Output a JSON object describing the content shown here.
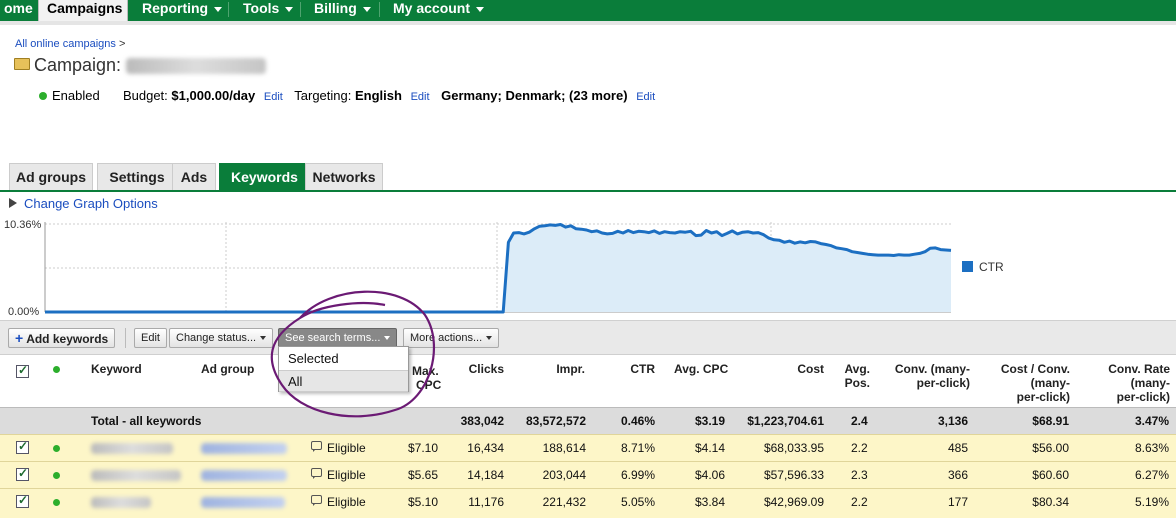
{
  "nav": {
    "items": [
      {
        "label": "ome"
      },
      {
        "label": "Campaigns"
      },
      {
        "label": "Reporting"
      },
      {
        "label": "Tools"
      },
      {
        "label": "Billing"
      },
      {
        "label": "My account"
      }
    ]
  },
  "breadcrumb": {
    "link": "All online campaigns",
    "sep": ">"
  },
  "campaign": {
    "title_prefix": "Campaign:",
    "status": "Enabled",
    "budget_label": "Budget:",
    "budget_value": "$1,000.00/day",
    "targeting_label": "Targeting:",
    "targeting_language": "English",
    "targeting_locations": "Germany; Denmark; (23 more)",
    "edit_label": "Edit"
  },
  "tabs": [
    "Ad groups",
    "Settings",
    "Ads",
    "Keywords",
    "Networks"
  ],
  "graph": {
    "options_link": "Change Graph Options"
  },
  "chart_data": {
    "type": "area",
    "series": [
      {
        "name": "CTR",
        "values": [
          0,
          0,
          0,
          0,
          0,
          0,
          0,
          0,
          0,
          0,
          0,
          0,
          0,
          0,
          0,
          0,
          0,
          0,
          0,
          0,
          0,
          0,
          0,
          0,
          0,
          0,
          0,
          0,
          0,
          0,
          0,
          0,
          0,
          0,
          0,
          0,
          0,
          0,
          0,
          0,
          0,
          0,
          0,
          0,
          0,
          0,
          0,
          0,
          0,
          0,
          0,
          0,
          0,
          0,
          0,
          0,
          0,
          0,
          0,
          0,
          0,
          0,
          0,
          0,
          0,
          0,
          0,
          0,
          0,
          0,
          0,
          0,
          0,
          0,
          0,
          0,
          0,
          0,
          0,
          0,
          0,
          0,
          0,
          0,
          0,
          0,
          0,
          0,
          0,
          8.2,
          9.3,
          9.35,
          9.2,
          9.4,
          9.8,
          10.1,
          10.15,
          10.25,
          10.2,
          10.3,
          10.0,
          10.15,
          9.8,
          9.75,
          9.65,
          9.45,
          9.55,
          9.3,
          9.2,
          9.25,
          9.5,
          9.3,
          9.6,
          9.35,
          9.5,
          9.45,
          9.35,
          9.55,
          9.25,
          9.45,
          9.35,
          9.3,
          9.45,
          9.4,
          9.5,
          9.0,
          9.05,
          9.6,
          9.3,
          9.45,
          9.0,
          9.25,
          9.55,
          9.2,
          9.4,
          9.45,
          9.3,
          9.35,
          9.1,
          8.7,
          8.5,
          8.45,
          8.2,
          8.35,
          8.1,
          8.25,
          8.15,
          8.3,
          8.25,
          8.05,
          7.95,
          7.8,
          7.55,
          7.45,
          7.35,
          7.1,
          7.0,
          6.9,
          6.8,
          6.75,
          6.7,
          6.7,
          6.7,
          6.65,
          6.75,
          6.7,
          6.7,
          6.8,
          6.9,
          7.1,
          7.5,
          7.55,
          7.35,
          7.3,
          7.25
        ]
      }
    ],
    "ylim": [
      0,
      10.36
    ],
    "ytick_labels": [
      "10.36%",
      "0.00%"
    ],
    "grid": true,
    "legend": "right"
  },
  "toolbar": {
    "add_keywords": "Add keywords",
    "edit": "Edit",
    "change_status": "Change status...",
    "see_search_terms": "See search terms...",
    "more_actions": "More actions..."
  },
  "dropdown": {
    "items": [
      "Selected",
      "All"
    ]
  },
  "table": {
    "headers": {
      "keyword": "Keyword",
      "ad_group": "Ad group",
      "max_cpc_1": "Max.",
      "max_cpc_2": "CPC",
      "clicks": "Clicks",
      "impr": "Impr.",
      "ctr": "CTR",
      "avg_cpc": "Avg. CPC",
      "cost": "Cost",
      "avg_pos_1": "Avg.",
      "avg_pos_2": "Pos.",
      "conv_1": "Conv. (many-",
      "conv_2": "per-click)",
      "cost_conv_1": "Cost / Conv.",
      "cost_conv_2": "(many-",
      "cost_conv_3": "per-click)",
      "conv_rate_1": "Conv. Rate",
      "conv_rate_2": "(many-",
      "conv_rate_3": "per-click)"
    },
    "total": {
      "label": "Total - all keywords",
      "clicks": "383,042",
      "impr": "83,572,572",
      "ctr": "0.46%",
      "avg_cpc": "$3.19",
      "cost": "$1,223,704.61",
      "avg_pos": "2.4",
      "conv": "3,136",
      "cost_conv": "$68.91",
      "conv_rate": "3.47%"
    },
    "rows": [
      {
        "status": "Eligible",
        "max_cpc": "$7.10",
        "clicks": "16,434",
        "impr": "188,614",
        "ctr": "8.71%",
        "avg_cpc": "$4.14",
        "cost": "$68,033.95",
        "avg_pos": "2.2",
        "conv": "485",
        "cost_conv": "$56.00",
        "conv_rate": "8.63%"
      },
      {
        "status": "Eligible",
        "max_cpc": "$5.65",
        "clicks": "14,184",
        "impr": "203,044",
        "ctr": "6.99%",
        "avg_cpc": "$4.06",
        "cost": "$57,596.33",
        "avg_pos": "2.3",
        "conv": "366",
        "cost_conv": "$60.60",
        "conv_rate": "6.27%"
      },
      {
        "status": "Eligible",
        "max_cpc": "$5.10",
        "clicks": "11,176",
        "impr": "221,432",
        "ctr": "5.05%",
        "avg_cpc": "$3.84",
        "cost": "$42,969.09",
        "avg_pos": "2.2",
        "conv": "177",
        "cost_conv": "$80.34",
        "conv_rate": "5.19%"
      }
    ]
  }
}
